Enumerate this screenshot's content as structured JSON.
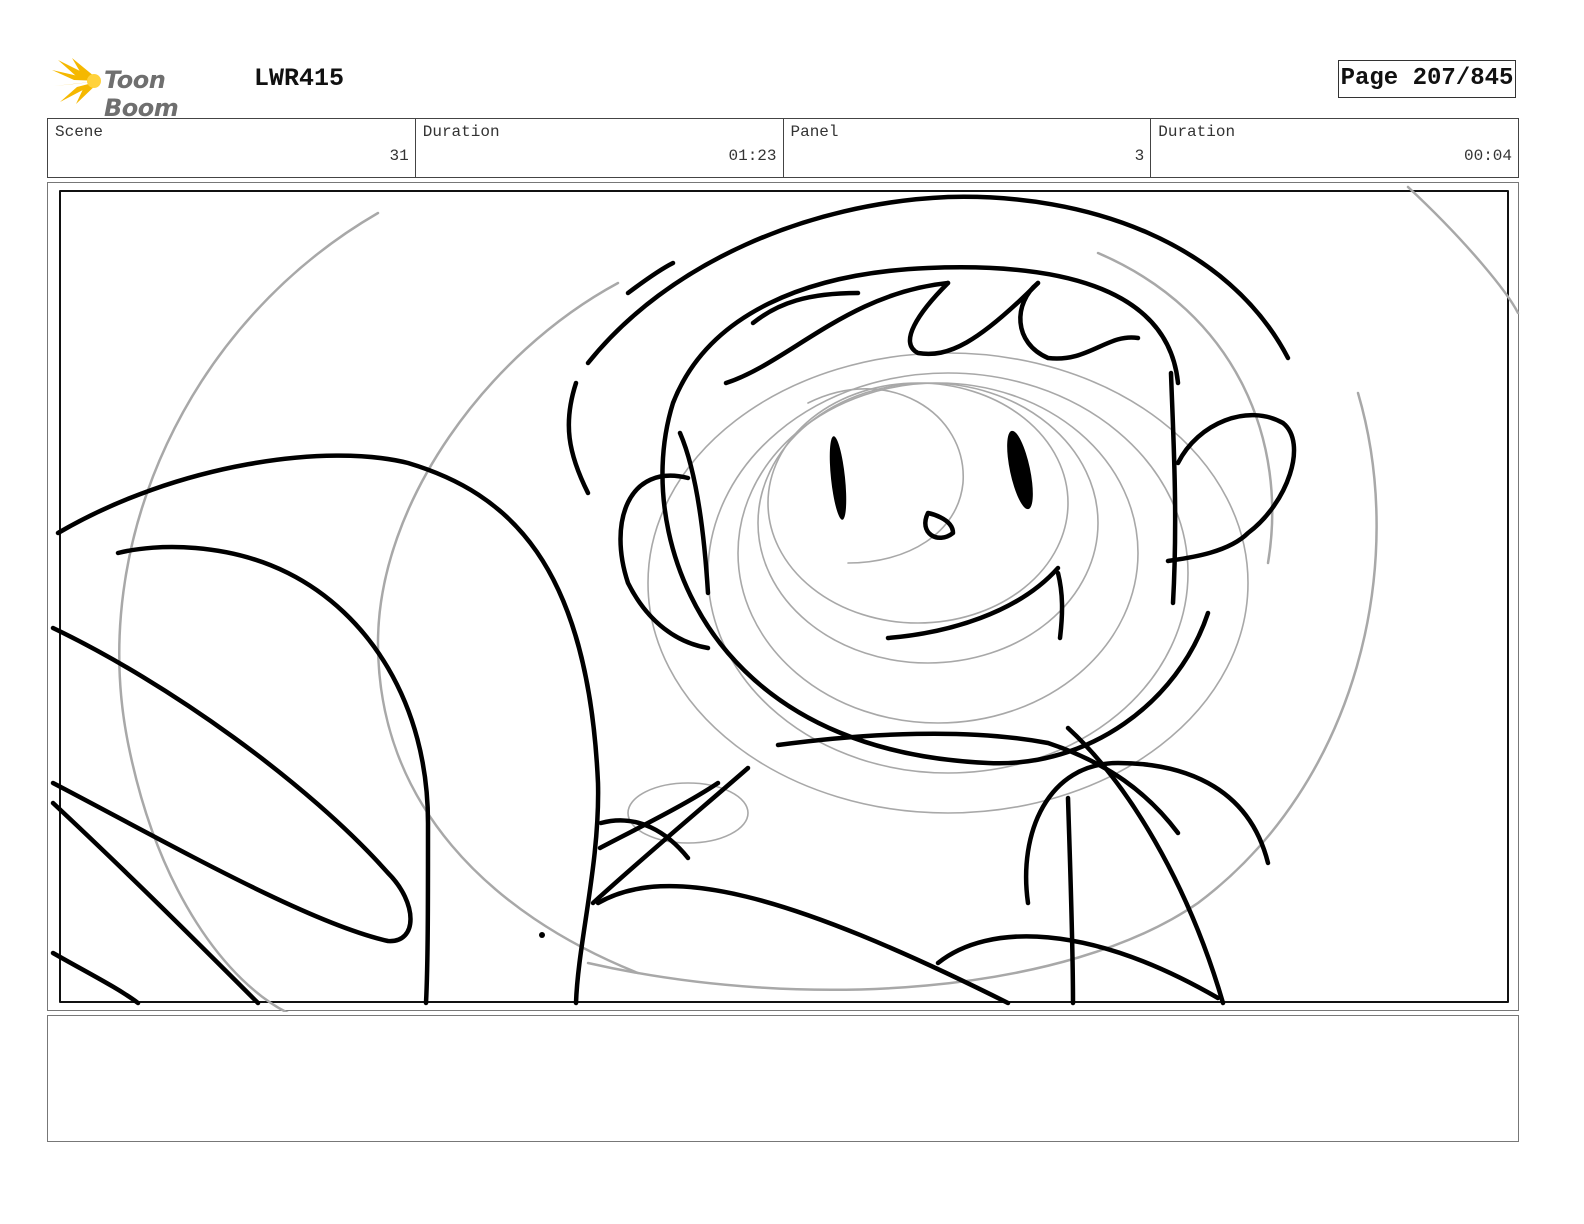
{
  "header": {
    "logo_text": "Toon Boom",
    "project_code": "LWR415",
    "page_label": "Page 207/845"
  },
  "info_bar": {
    "scene_label": "Scene",
    "scene_value": "31",
    "scene_duration_label": "Duration",
    "scene_duration_value": "01:23",
    "panel_label": "Panel",
    "panel_value": "3",
    "panel_duration_label": "Duration",
    "panel_duration_value": "00:04"
  },
  "panel": {
    "image": "storyboard-sketch"
  },
  "notes": {
    "text": ""
  },
  "colors": {
    "logo_accent": "#f5b800",
    "sketch_ink": "#000000",
    "guide_lines": "#a8a8a8"
  }
}
